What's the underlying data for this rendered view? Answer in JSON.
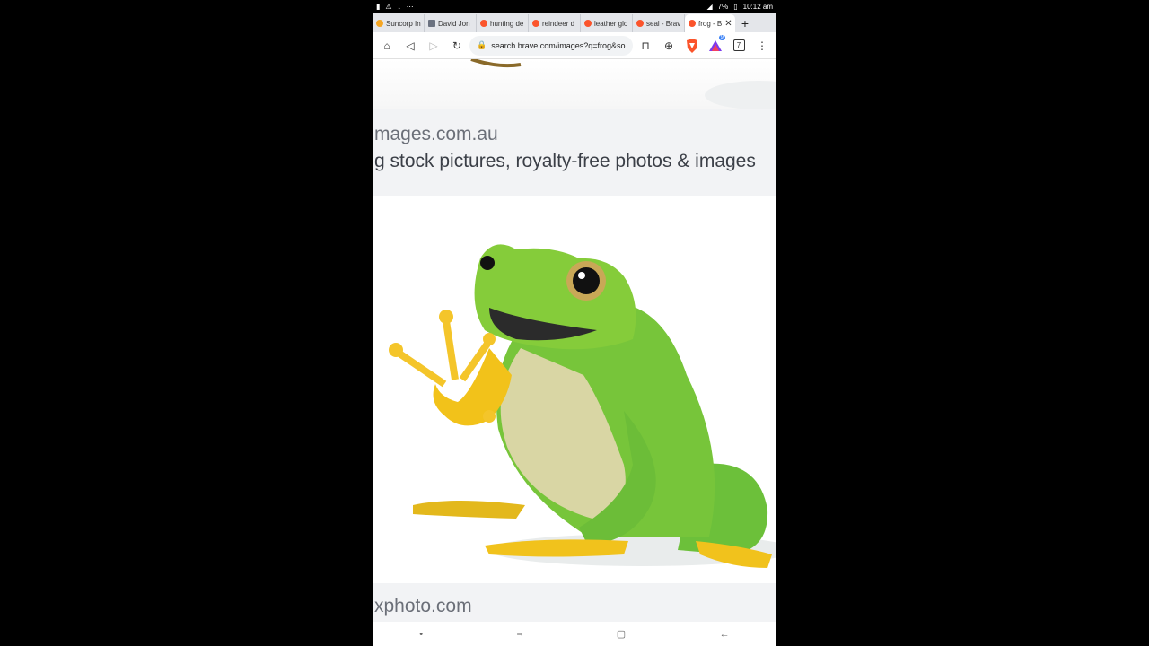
{
  "status": {
    "time": "10:12 am",
    "battery": "7%"
  },
  "tabs": [
    {
      "label": "Suncorp In",
      "color": "#f5a623"
    },
    {
      "label": "David Jon",
      "color": "#6b7280"
    },
    {
      "label": "hunting de",
      "color": "#fb542b"
    },
    {
      "label": "reindeer d",
      "color": "#fb542b"
    },
    {
      "label": "leather glo",
      "color": "#fb542b"
    },
    {
      "label": "seal - Brav",
      "color": "#fb542b"
    },
    {
      "label": "frog - B",
      "color": "#fb542b"
    }
  ],
  "toolbar": {
    "url": "search.brave.com/images?q=frog&so",
    "tab_count": "7",
    "rewards_badge": "9"
  },
  "results": [
    {
      "source": "mages.com.au",
      "title": "g stock pictures, royalty-free photos & images"
    },
    {
      "source": "xphoto.com"
    }
  ],
  "colors": {
    "brave_orange": "#fb542b",
    "frog_green": "#7cc531"
  },
  "icons": {
    "home": "home-icon",
    "back": "back-icon",
    "forward": "forward-icon",
    "reload": "reload-icon",
    "lock": "lock-icon",
    "bookmark": "bookmark-icon",
    "download": "download-icon",
    "brave_shield": "brave-shield-icon",
    "rewards": "rewards-icon",
    "menu": "menu-icon"
  }
}
